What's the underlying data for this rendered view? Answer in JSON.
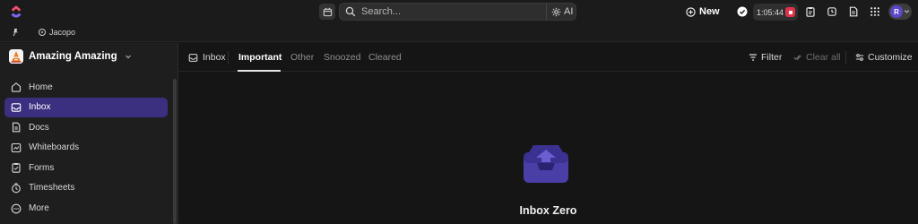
{
  "topbar": {
    "search_placeholder": "Search...",
    "ai_label": "AI",
    "new_label": "New",
    "timer": "1:05:44",
    "avatar_initial": "R"
  },
  "location": {
    "label": "Jacopo"
  },
  "workspace": {
    "name": "Amazing Amazing"
  },
  "sidebar": {
    "items": [
      {
        "label": "Home",
        "icon": "home-icon"
      },
      {
        "label": "Inbox",
        "icon": "inbox-icon",
        "active": true
      },
      {
        "label": "Docs",
        "icon": "docs-icon"
      },
      {
        "label": "Whiteboards",
        "icon": "whiteboard-icon"
      },
      {
        "label": "Forms",
        "icon": "forms-icon"
      },
      {
        "label": "Timesheets",
        "icon": "timesheets-icon"
      },
      {
        "label": "More",
        "icon": "more-icon"
      }
    ]
  },
  "main": {
    "inbox_label": "Inbox",
    "tabs": [
      {
        "label": "Important",
        "selected": true
      },
      {
        "label": "Other"
      },
      {
        "label": "Snoozed"
      },
      {
        "label": "Cleared"
      }
    ],
    "filter_label": "Filter",
    "clear_all_label": "Clear all",
    "customize_label": "Customize",
    "empty_title": "Inbox Zero"
  },
  "colors": {
    "accent": "#3b2f80",
    "timer_stop": "#e0334a",
    "avatar": "#5a48c9",
    "illustration": "#4a3fa6"
  }
}
